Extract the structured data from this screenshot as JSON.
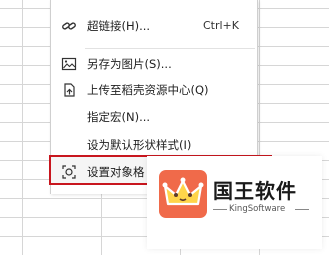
{
  "menu": {
    "items": [
      {
        "label": "超链接(H)...",
        "shortcut": "Ctrl+K",
        "icon": "link-icon"
      },
      {
        "label": "另存为图片(S)...",
        "icon": "save-image-icon"
      },
      {
        "label": "上传至稻壳资源中心(Q)",
        "icon": "upload-cloud-icon"
      },
      {
        "label": "指定宏(N)...",
        "icon": ""
      },
      {
        "label": "设为默认形状样式(I)",
        "icon": ""
      },
      {
        "label": "设置对象格",
        "icon": "format-object-icon"
      }
    ]
  },
  "brand": {
    "name": "国王软件",
    "sub": "KingSoftware",
    "color": "#f06a4a",
    "crown_color": "#ffd54a"
  },
  "highlight_color": "#c8161e"
}
